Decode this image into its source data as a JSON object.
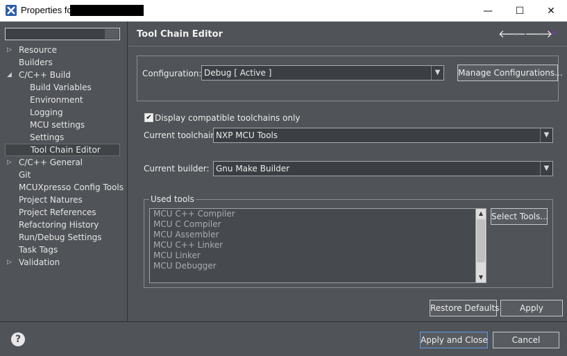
{
  "window": {
    "title": "Properties for",
    "icon": "x-icon",
    "controls": {
      "minimize": "—",
      "maximize": "☐",
      "close": "✕"
    }
  },
  "sidebar": {
    "filter_value": "",
    "items": [
      {
        "label": "Resource",
        "indent": 1,
        "expander": "▷"
      },
      {
        "label": "Builders",
        "indent": 1,
        "expander": ""
      },
      {
        "label": "C/C++ Build",
        "indent": 1,
        "expander": "◢"
      },
      {
        "label": "Build Variables",
        "indent": 2,
        "expander": ""
      },
      {
        "label": "Environment",
        "indent": 2,
        "expander": ""
      },
      {
        "label": "Logging",
        "indent": 2,
        "expander": ""
      },
      {
        "label": "MCU settings",
        "indent": 2,
        "expander": ""
      },
      {
        "label": "Settings",
        "indent": 2,
        "expander": ""
      },
      {
        "label": "Tool Chain Editor",
        "indent": 2,
        "expander": "",
        "selected": true
      },
      {
        "label": "C/C++ General",
        "indent": 1,
        "expander": "▷"
      },
      {
        "label": "Git",
        "indent": 1,
        "expander": ""
      },
      {
        "label": "MCUXpresso Config Tools",
        "indent": 1,
        "expander": ""
      },
      {
        "label": "Project Natures",
        "indent": 1,
        "expander": ""
      },
      {
        "label": "Project References",
        "indent": 1,
        "expander": ""
      },
      {
        "label": "Refactoring History",
        "indent": 1,
        "expander": ""
      },
      {
        "label": "Run/Debug Settings",
        "indent": 1,
        "expander": ""
      },
      {
        "label": "Task Tags",
        "indent": 1,
        "expander": ""
      },
      {
        "label": "Validation",
        "indent": 1,
        "expander": "▷"
      }
    ]
  },
  "main": {
    "title": "Tool Chain Editor",
    "nav": {
      "back": "🡐",
      "forward": "🡒",
      "dropdown": "▾",
      "menu": "▾"
    },
    "configuration_label": "Configuration:",
    "configuration_value": "Debug  [ Active ]",
    "manage_button": "Manage Configurations...",
    "compatible_checkbox": {
      "label": "Display compatible toolchains only",
      "checked": true
    },
    "toolchain_label": "Current toolchain:",
    "toolchain_value": "NXP MCU Tools",
    "builder_label": "Current builder:",
    "builder_value": "Gnu Make Builder",
    "used_tools_legend": "Used tools",
    "used_tools": [
      "MCU C++ Compiler",
      "MCU C Compiler",
      "MCU Assembler",
      "MCU C++ Linker",
      "MCU Linker",
      "MCU Debugger"
    ],
    "select_tools_button": "Select Tools...",
    "restore_defaults_button": "Restore Defaults",
    "apply_button": "Apply"
  },
  "footer": {
    "help": "?",
    "apply_close_button": "Apply and Close",
    "cancel_button": "Cancel"
  },
  "colors": {
    "background": "#505357",
    "accent": "#5aa0e6",
    "nav_menu": "#7a3aa6"
  }
}
